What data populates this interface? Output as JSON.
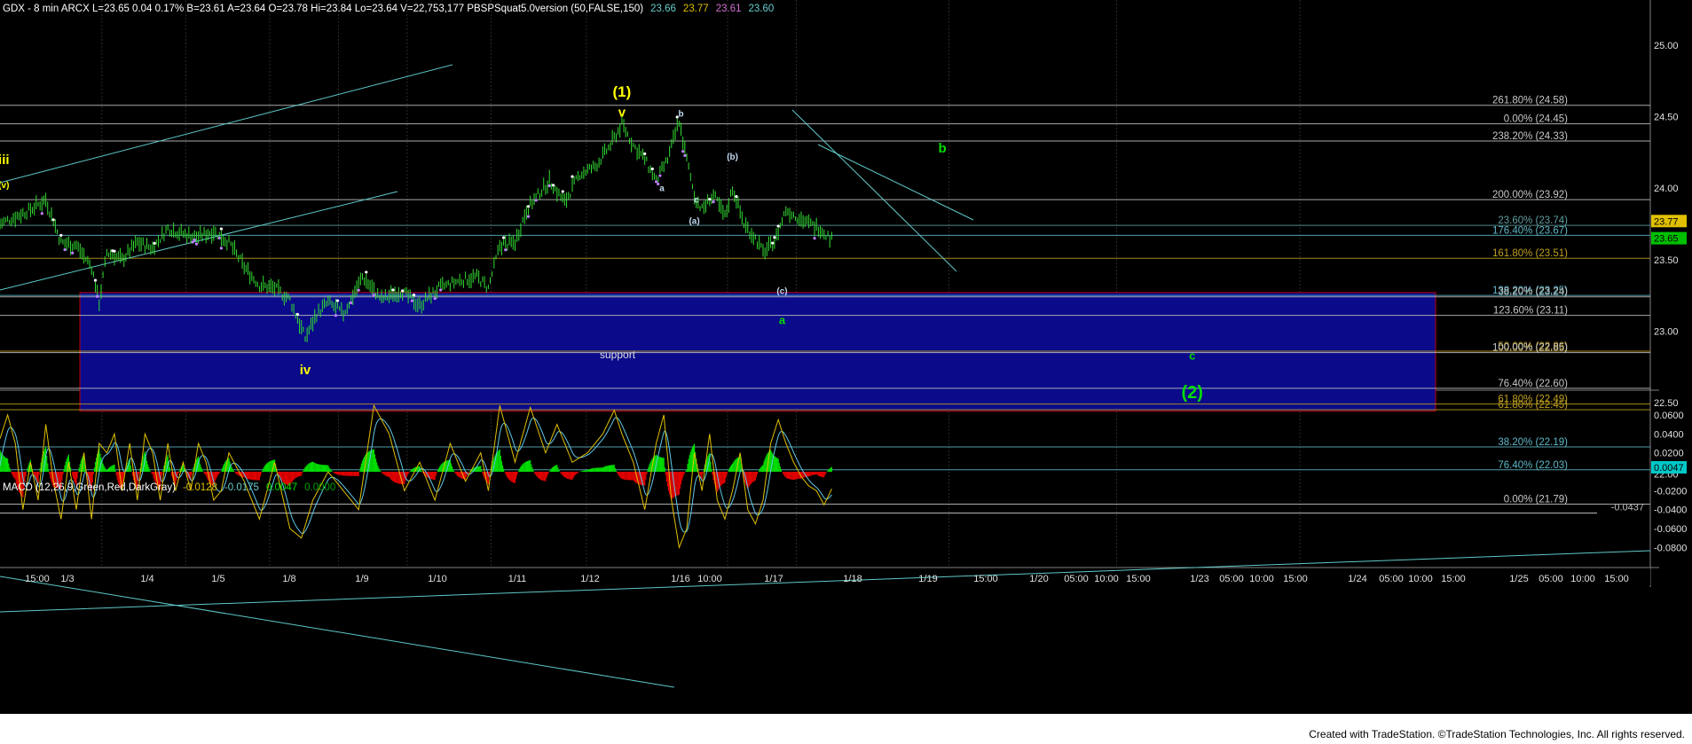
{
  "header": {
    "title": "GDX - 8 min  ARCX  L=23.65  0.04  0.17%  B=23.61  A=23.64  O=23.78  Hi=23.84  Lo=23.64  V=22,753,177  PBSPSquat5.0version (50,FALSE,150)",
    "values": [
      {
        "text": "23.66",
        "color": "#66cccc"
      },
      {
        "text": "23.77",
        "color": "#e0c000"
      },
      {
        "text": "23.61",
        "color": "#d070d0"
      },
      {
        "text": "23.60",
        "color": "#66cccc"
      }
    ]
  },
  "macd_header": {
    "title": "MACD (12,26,9,Green,Red,DarkGray)",
    "values": [
      {
        "text": "-0.0128",
        "color": "#e0c000"
      },
      {
        "text": "-0.0175",
        "color": "#66cccc"
      },
      {
        "text": "0.0047",
        "color": "#00e000"
      },
      {
        "text": "0.0000",
        "color": "#00a000"
      }
    ]
  },
  "price_axis": [
    {
      "v": 25.0,
      "label": "25.00"
    },
    {
      "v": 24.5,
      "label": "24.50"
    },
    {
      "v": 24.0,
      "label": "24.00"
    },
    {
      "v": 23.5,
      "label": "23.50"
    },
    {
      "v": 23.0,
      "label": "23.00"
    },
    {
      "v": 22.5,
      "label": "22.50"
    },
    {
      "v": 22.0,
      "label": "22.00"
    }
  ],
  "price_tags": [
    {
      "v": 23.77,
      "label": "23.77",
      "bg": "#e0c000"
    },
    {
      "v": 23.65,
      "label": "23.65",
      "bg": "#00c000"
    }
  ],
  "macd_axis": [
    {
      "v": 0.06,
      "label": "0.0600"
    },
    {
      "v": 0.04,
      "label": "0.0400"
    },
    {
      "v": 0.02,
      "label": "0.0200"
    },
    {
      "v": -0.02,
      "label": "-0.0200"
    },
    {
      "v": -0.04,
      "label": "-0.0400"
    },
    {
      "v": -0.06,
      "label": "-0.0600"
    },
    {
      "v": -0.08,
      "label": "-0.0800"
    }
  ],
  "macd_tag": {
    "v": 0.0047,
    "label": "0.0047"
  },
  "macd_level": {
    "v": -0.0437,
    "label": "-0.0437"
  },
  "time_axis": [
    "15:00",
    "1/3",
    "1/4",
    "1/5",
    "1/8",
    "1/9",
    "1/10",
    "1/11",
    "1/12",
    "1/16",
    "10:00",
    "1/17",
    "1/18",
    "1/19",
    "15:00",
    "1/20",
    "05:00",
    "10:00",
    "15:00",
    "1/23",
    "05:00",
    "10:00",
    "15:00",
    "1/24",
    "05:00",
    "10:00",
    "15:00",
    "1/25",
    "05:00",
    "10:00",
    "15:00"
  ],
  "fib_levels": [
    {
      "v": 24.58,
      "label": "261.80% (24.58)",
      "color": "#c8c8c8"
    },
    {
      "v": 24.45,
      "label": "0.00% (24.45)",
      "color": "#c8c8c8"
    },
    {
      "v": 24.33,
      "label": "238.20% (24.33)",
      "color": "#c8c8c8"
    },
    {
      "v": 23.92,
      "label": "200.00% (23.92)",
      "color": "#c8c8c8"
    },
    {
      "v": 23.74,
      "label": "23.60% (23.74)",
      "color": "#5f9ea0"
    },
    {
      "v": 23.67,
      "label": "176.40% (23.67)",
      "color": "#5fb8c8"
    },
    {
      "v": 23.51,
      "label": "161.80% (23.51)",
      "color": "#c0a020"
    },
    {
      "v": 23.25,
      "label": "138.20% (23.25)",
      "color": "#5fb8c8"
    },
    {
      "v": 23.24,
      "label": "38.20% (23.24)",
      "color": "#c0c0c0"
    },
    {
      "v": 23.11,
      "label": "123.60% (23.11)",
      "color": "#c8c8c8"
    },
    {
      "v": 22.86,
      "label": "50.00% (22.86)",
      "color": "#c0a020"
    },
    {
      "v": 22.85,
      "label": "100.00% (22.85)",
      "color": "#c8c8c8"
    },
    {
      "v": 22.6,
      "label": "76.40% (22.60)",
      "color": "#c8c8c8"
    },
    {
      "v": 22.49,
      "label": "61.80% (22.49)",
      "color": "#c0a020"
    },
    {
      "v": 22.45,
      "label": "61.80% (22.45)",
      "color": "#c0a020"
    },
    {
      "v": 22.19,
      "label": "38.20% (22.19)",
      "color": "#5fb8c8"
    },
    {
      "v": 22.03,
      "label": "76.40% (22.03)",
      "color": "#5fb8c8"
    },
    {
      "v": 21.79,
      "label": "0.00% (21.79)",
      "color": "#c8c8c8"
    }
  ],
  "support_zone": {
    "top": 23.27,
    "bottom": 22.44,
    "label": "support"
  },
  "wave_labels": [
    {
      "t": 1,
      "v": 24.17,
      "text": "iii",
      "color": "#ffff00",
      "size": 15
    },
    {
      "t": 1,
      "v": 24.0,
      "text": "(v)",
      "color": "#ffff00",
      "size": 10
    },
    {
      "t": 80,
      "v": 22.7,
      "text": "iv",
      "color": "#ffff00",
      "size": 15
    },
    {
      "t": 163,
      "v": 24.64,
      "text": "(1)",
      "color": "#ffff00",
      "size": 17
    },
    {
      "t": 163,
      "v": 24.5,
      "text": "v",
      "color": "#ffff00",
      "size": 15
    },
    {
      "t": 178.5,
      "v": 24.5,
      "text": "b",
      "color": "#c0d8f0",
      "size": 10
    },
    {
      "t": 173.5,
      "v": 23.98,
      "text": "a",
      "color": "#c0d8f0",
      "size": 10
    },
    {
      "t": 182.5,
      "v": 23.9,
      "text": "c",
      "color": "#c0d8f0",
      "size": 10
    },
    {
      "t": 182,
      "v": 23.75,
      "text": "(a)",
      "color": "#c0d8f0",
      "size": 10
    },
    {
      "t": 192,
      "v": 24.2,
      "text": "(b)",
      "color": "#c0d8f0",
      "size": 10
    },
    {
      "t": 205,
      "v": 23.26,
      "text": "(c)",
      "color": "#c0d8f0",
      "size": 10
    },
    {
      "t": 205,
      "v": 23.05,
      "text": "a",
      "color": "#00dd00",
      "size": 13
    },
    {
      "t": 247,
      "v": 24.25,
      "text": "b",
      "color": "#00dd00",
      "size": 15
    },
    {
      "t": 312.5,
      "v": 22.8,
      "text": "c",
      "color": "#00dd00",
      "size": 13
    },
    {
      "t": 312.5,
      "v": 22.53,
      "text": "(2)",
      "color": "#00dd00",
      "size": 20
    }
  ],
  "price_anchors": [
    [
      0,
      23.75
    ],
    [
      4,
      23.8
    ],
    [
      8,
      23.85
    ],
    [
      12,
      23.92
    ],
    [
      16,
      23.62
    ],
    [
      20,
      23.6
    ],
    [
      24,
      23.45
    ],
    [
      26,
      23.2
    ],
    [
      28,
      23.55
    ],
    [
      32,
      23.5
    ],
    [
      36,
      23.62
    ],
    [
      40,
      23.58
    ],
    [
      44,
      23.72
    ],
    [
      48,
      23.68
    ],
    [
      52,
      23.66
    ],
    [
      56,
      23.7
    ],
    [
      60,
      23.62
    ],
    [
      64,
      23.45
    ],
    [
      68,
      23.32
    ],
    [
      72,
      23.3
    ],
    [
      76,
      23.22
    ],
    [
      80,
      22.95
    ],
    [
      83,
      23.12
    ],
    [
      86,
      23.2
    ],
    [
      90,
      23.12
    ],
    [
      95,
      23.38
    ],
    [
      100,
      23.22
    ],
    [
      105,
      23.28
    ],
    [
      110,
      23.18
    ],
    [
      115,
      23.3
    ],
    [
      120,
      23.35
    ],
    [
      125,
      23.38
    ],
    [
      128,
      23.3
    ],
    [
      131,
      23.6
    ],
    [
      135,
      23.62
    ],
    [
      138,
      23.85
    ],
    [
      141,
      23.95
    ],
    [
      144,
      24.05
    ],
    [
      148,
      23.9
    ],
    [
      152,
      24.1
    ],
    [
      156,
      24.15
    ],
    [
      160,
      24.3
    ],
    [
      163,
      24.45
    ],
    [
      166,
      24.3
    ],
    [
      169,
      24.2
    ],
    [
      172,
      24.05
    ],
    [
      175,
      24.2
    ],
    [
      178,
      24.47
    ],
    [
      180,
      24.2
    ],
    [
      182,
      23.95
    ],
    [
      184,
      23.85
    ],
    [
      187,
      23.95
    ],
    [
      190,
      23.8
    ],
    [
      192,
      24.0
    ],
    [
      195,
      23.75
    ],
    [
      198,
      23.65
    ],
    [
      200,
      23.55
    ],
    [
      203,
      23.62
    ],
    [
      206,
      23.85
    ],
    [
      209,
      23.8
    ],
    [
      212,
      23.75
    ],
    [
      215,
      23.72
    ],
    [
      218,
      23.64
    ]
  ],
  "macd_anchors": [
    [
      0,
      0.035
    ],
    [
      2,
      0.06
    ],
    [
      4,
      0.03
    ],
    [
      6,
      -0.04
    ],
    [
      8,
      0.01
    ],
    [
      10,
      -0.03
    ],
    [
      12,
      0.05
    ],
    [
      14,
      -0.01
    ],
    [
      16,
      -0.05
    ],
    [
      18,
      0.01
    ],
    [
      20,
      -0.04
    ],
    [
      22,
      0.02
    ],
    [
      24,
      -0.05
    ],
    [
      26,
      0.03
    ],
    [
      28,
      0.02
    ],
    [
      30,
      0.04
    ],
    [
      32,
      -0.02
    ],
    [
      34,
      0.03
    ],
    [
      36,
      -0.03
    ],
    [
      38,
      0.04
    ],
    [
      40,
      0.02
    ],
    [
      42,
      -0.03
    ],
    [
      44,
      0.03
    ],
    [
      46,
      -0.02
    ],
    [
      48,
      0.01
    ],
    [
      50,
      -0.02
    ],
    [
      52,
      0.03
    ],
    [
      54,
      0.01
    ],
    [
      56,
      -0.03
    ],
    [
      58,
      -0.02
    ],
    [
      60,
      0.02
    ],
    [
      64,
      -0.01
    ],
    [
      68,
      -0.05
    ],
    [
      72,
      0.01
    ],
    [
      76,
      -0.06
    ],
    [
      79,
      -0.07
    ],
    [
      82,
      -0.03
    ],
    [
      86,
      0.0
    ],
    [
      90,
      -0.02
    ],
    [
      94,
      -0.04
    ],
    [
      98,
      0.07
    ],
    [
      102,
      0.04
    ],
    [
      106,
      -0.02
    ],
    [
      110,
      0.01
    ],
    [
      114,
      -0.03
    ],
    [
      118,
      0.03
    ],
    [
      122,
      -0.01
    ],
    [
      126,
      0.02
    ],
    [
      128,
      -0.02
    ],
    [
      131,
      0.07
    ],
    [
      135,
      0.01
    ],
    [
      139,
      0.068
    ],
    [
      143,
      0.02
    ],
    [
      146,
      0.05
    ],
    [
      150,
      0.01
    ],
    [
      154,
      0.02
    ],
    [
      158,
      0.04
    ],
    [
      161,
      0.065
    ],
    [
      163,
      0.04
    ],
    [
      166,
      0.01
    ],
    [
      169,
      -0.04
    ],
    [
      172,
      0.03
    ],
    [
      174,
      0.06
    ],
    [
      176,
      -0.03
    ],
    [
      178,
      -0.08
    ],
    [
      180,
      -0.06
    ],
    [
      182,
      0.02
    ],
    [
      184,
      -0.02
    ],
    [
      186,
      0.04
    ],
    [
      188,
      -0.03
    ],
    [
      190,
      -0.05
    ],
    [
      192,
      -0.02
    ],
    [
      194,
      0.02
    ],
    [
      196,
      -0.04
    ],
    [
      198,
      -0.055
    ],
    [
      200,
      -0.03
    ],
    [
      202,
      0.03
    ],
    [
      204,
      0.055
    ],
    [
      206,
      0.03
    ],
    [
      208,
      0.01
    ],
    [
      210,
      -0.005
    ],
    [
      212,
      -0.015
    ],
    [
      214,
      -0.02
    ],
    [
      216,
      -0.035
    ],
    [
      218,
      -0.018
    ]
  ]
}
